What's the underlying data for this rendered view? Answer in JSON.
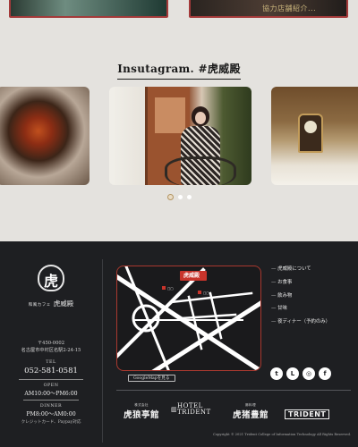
{
  "top_cards": {
    "left_text": "",
    "right_text": "協力店舗紹介..."
  },
  "instagram": {
    "heading": "Insutagram. #虎威殿",
    "slides": [
      "food",
      "woman-cafe",
      "interior"
    ],
    "active_index": 0
  },
  "footer": {
    "brand": {
      "logo_glyph": "虎",
      "sub": "和風カフェ",
      "name": "虎威殿"
    },
    "address": {
      "postal": "〒450-0002",
      "line": "名古屋市中村区名駅2-24-15"
    },
    "tel": {
      "label": "TEL",
      "number": "052-581-0581"
    },
    "open": {
      "label": "OPEN",
      "hours": "AM10:00～PM6:00"
    },
    "dinner": {
      "label": "DINNER",
      "hours": "PM8:00～AM0:00"
    },
    "payment_note": "クレジットカード、Paypay対応",
    "map": {
      "store_label": "虎威殿",
      "button_label": "GoogleMapを見る"
    },
    "nav": [
      "虎威殿について",
      "お食事",
      "飲み物",
      "甘味",
      "夜ディナー（予約のみ）"
    ],
    "social": [
      {
        "icon": "twitter-icon",
        "glyph": "t"
      },
      {
        "icon": "line-icon",
        "glyph": "L"
      },
      {
        "icon": "instagram-icon",
        "glyph": "◎"
      },
      {
        "icon": "facebook-icon",
        "glyph": "f"
      }
    ],
    "partners": [
      {
        "small": "株式会社",
        "name": "虎狼亭館"
      },
      {
        "small": "",
        "name": "HOTEL TRIDENT"
      },
      {
        "small": "豚料理",
        "name": "虎猪豊館"
      },
      {
        "small": "",
        "name": "TRIDENT"
      }
    ],
    "copyright": "Copyright © 2021 Trident College of Information Technology All Rights Reserved."
  },
  "colors": {
    "page_bg": "#e4e2de",
    "footer_bg": "#1e1f22",
    "accent_red": "#a9392f"
  }
}
